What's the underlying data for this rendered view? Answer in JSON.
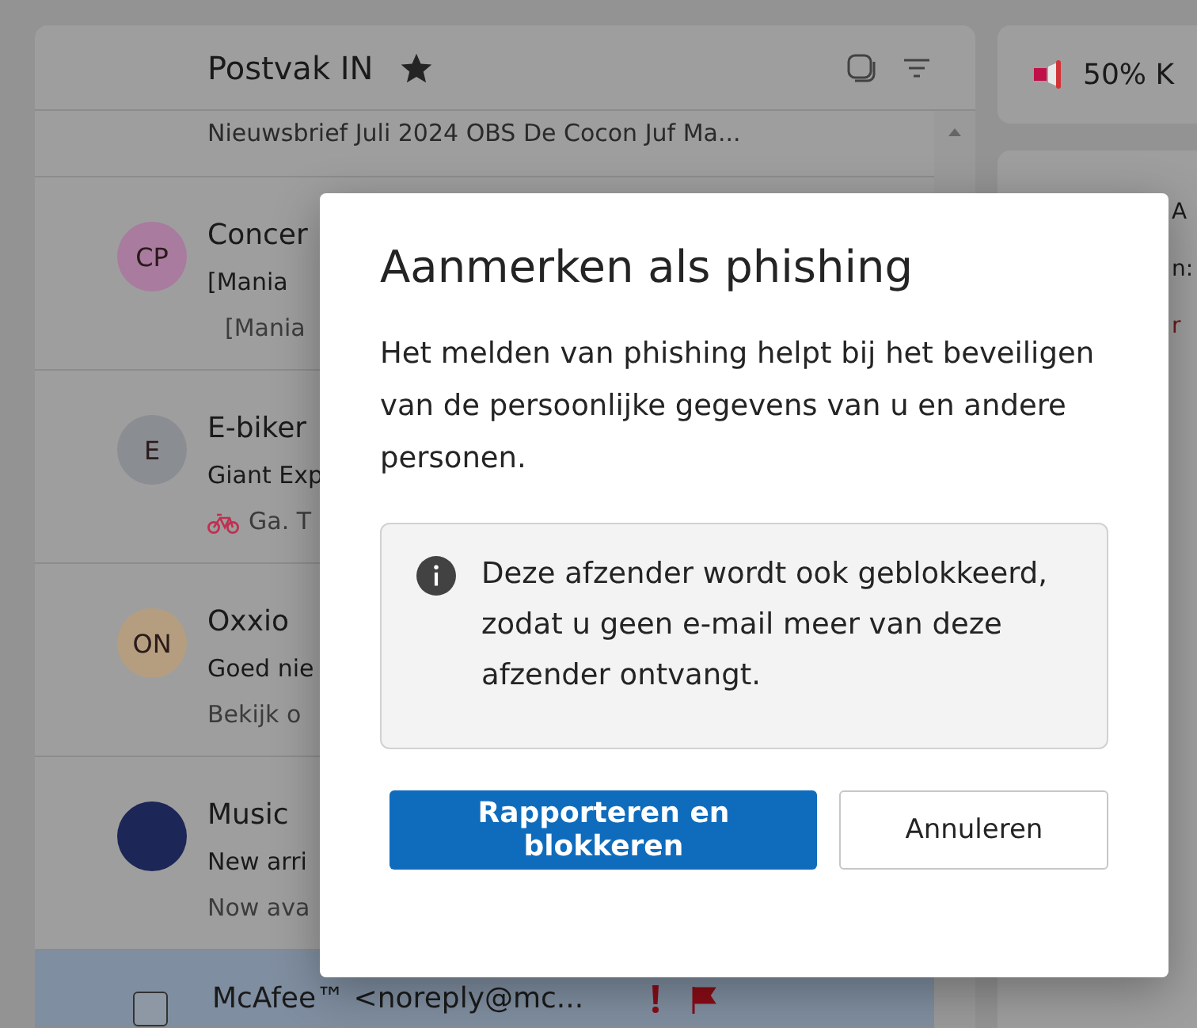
{
  "mail_list": {
    "title": "Postvak IN",
    "preview_top": "Nieuwsbrief Juli 2024 OBS De Cocon Juf Ma...",
    "messages": [
      {
        "kind": "avatar",
        "initials": "CP",
        "color": "#a87b9f",
        "sender": "Concer",
        "line_2": "[Mania",
        "line_3": "[Mania",
        "selected": false
      },
      {
        "kind": "avatar",
        "initials": "E",
        "color": "#8a8d91",
        "sender": "E-biker",
        "line_2": "Giant Exp",
        "line_3": "Ga. T",
        "selected": false
      },
      {
        "kind": "avatar",
        "initials": "ON",
        "color": "#b59e7f",
        "sender": "Oxxio",
        "line_2": "Goed nie",
        "line_3": "Bekijk o",
        "selected": false
      },
      {
        "kind": "avatar",
        "color": "#1c2657",
        "sender": "Music",
        "line_2": "New arri",
        "line_3": "Now ava",
        "selected": false
      },
      {
        "kind": "checkbox",
        "sender": "McAfee™ <noreply@mc...",
        "important": true,
        "flagged": true,
        "selected": true
      }
    ]
  },
  "side": {
    "promo": "50% K",
    "fragments": [
      "A",
      "n:",
      "r"
    ]
  },
  "dialog": {
    "title": "Aanmerken als phishing",
    "body": "Het melden van phishing helpt bij het beveiligen van de persoonlijke gegevens van u en andere personen.",
    "info": "Deze afzender wordt ook geblokkeerd, zodat u geen e-mail meer van deze afzender ontvangt.",
    "buttons": [
      {
        "label": "Rapporteren en blokkeren",
        "kind": "primary"
      },
      {
        "label": "Annuleren",
        "kind": "secondary"
      }
    ]
  }
}
